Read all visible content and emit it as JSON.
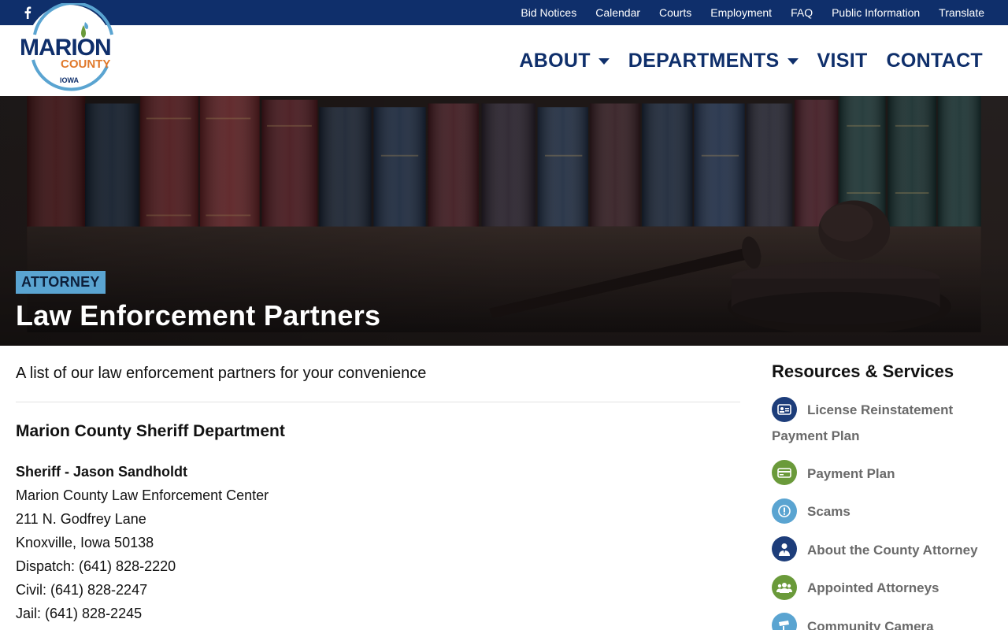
{
  "utility_bar": {
    "social": [
      {
        "name": "facebook-icon"
      },
      {
        "name": "youtube-icon"
      }
    ],
    "links": [
      "Bid Notices",
      "Calendar",
      "Courts",
      "Employment",
      "FAQ",
      "Public Information",
      "Translate"
    ]
  },
  "header": {
    "logo": {
      "line1": "MARION",
      "line2": "COUNTY",
      "line3": "IOWA"
    },
    "nav": [
      {
        "label": "ABOUT",
        "has_dropdown": true
      },
      {
        "label": "DEPARTMENTS",
        "has_dropdown": true
      },
      {
        "label": "VISIT",
        "has_dropdown": false
      },
      {
        "label": "CONTACT",
        "has_dropdown": false
      }
    ]
  },
  "hero": {
    "tag": "ATTORNEY",
    "title": "Law Enforcement Partners"
  },
  "main": {
    "intro": "A list of our law enforcement partners for your convenience",
    "section_title": "Marion County Sheriff Department",
    "contact": {
      "heading": "Sheriff - Jason Sandholdt",
      "lines": [
        "Marion County Law Enforcement Center",
        "211 N. Godfrey Lane",
        "Knoxville, Iowa 50138",
        "Dispatch: (641) 828-2220",
        "Civil: (641) 828-2247",
        "Jail: (641) 828-2245"
      ]
    }
  },
  "sidebar": {
    "title": "Resources & Services",
    "items": [
      {
        "label": "License Reinstatement Payment Plan",
        "icon": "id-card-icon",
        "color": "#1d3d7a"
      },
      {
        "label": "Payment Plan",
        "icon": "credit-card-icon",
        "color": "#6a9a3a"
      },
      {
        "label": "Scams",
        "icon": "alert-icon",
        "color": "#5aa4d1"
      },
      {
        "label": "About the County Attorney",
        "icon": "attorney-icon",
        "color": "#1d3d7a"
      },
      {
        "label": "Appointed Attorneys",
        "icon": "group-icon",
        "color": "#6a9a3a"
      },
      {
        "label": "Community Camera",
        "icon": "camera-icon",
        "color": "#5aa4d1"
      }
    ]
  },
  "colors": {
    "brand_navy": "#0f2f6b",
    "brand_blue": "#5aa4d1",
    "brand_green": "#6a9a3a",
    "brand_orange": "#e0782a"
  }
}
